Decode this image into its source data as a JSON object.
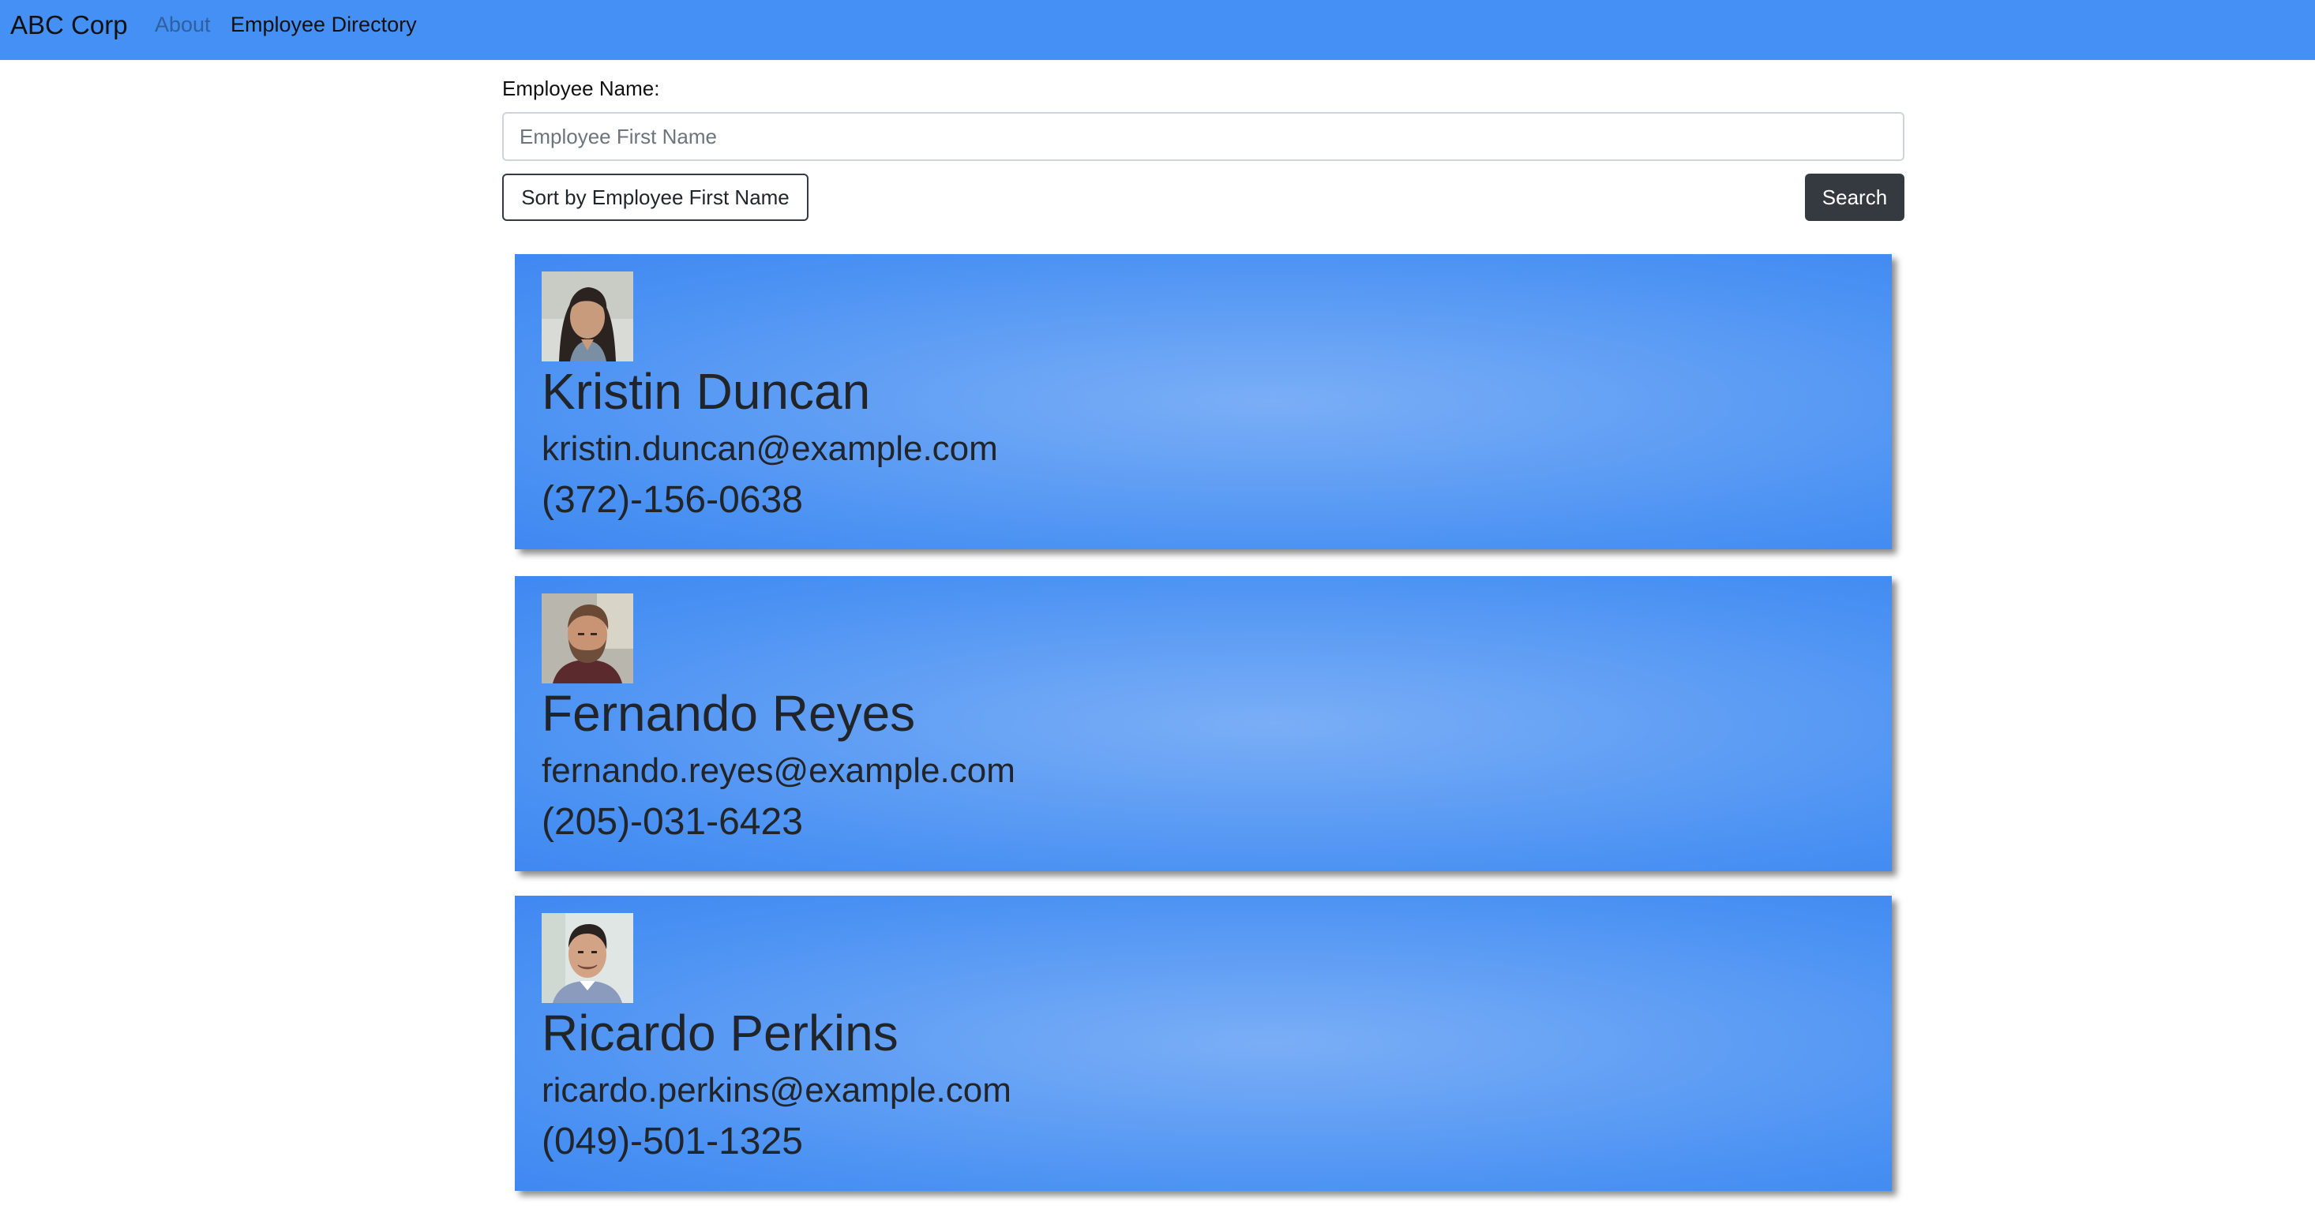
{
  "navbar": {
    "brand": "ABC Corp",
    "links": [
      {
        "label": "About"
      },
      {
        "label": "Employee Directory"
      }
    ]
  },
  "search": {
    "label": "Employee Name:",
    "placeholder": "Employee First Name",
    "value": "",
    "sort_label": "Sort by Employee First Name",
    "search_label": "Search"
  },
  "employees": [
    {
      "name": "Kristin Duncan",
      "email": "kristin.duncan@example.com",
      "phone": "(372)-156-0638",
      "avatar_icon": "woman-portrait-photo"
    },
    {
      "name": "Fernando Reyes",
      "email": "fernando.reyes@example.com",
      "phone": "(205)-031-6423",
      "avatar_icon": "bearded-man-portrait-photo"
    },
    {
      "name": "Ricardo Perkins",
      "email": "ricardo.perkins@example.com",
      "phone": "(049)-501-1325",
      "avatar_icon": "smiling-man-portrait-photo"
    }
  ],
  "colors": {
    "navbar_bg": "#4590f4",
    "card_bg": "#4a91f3",
    "search_button_bg": "#343a40"
  }
}
